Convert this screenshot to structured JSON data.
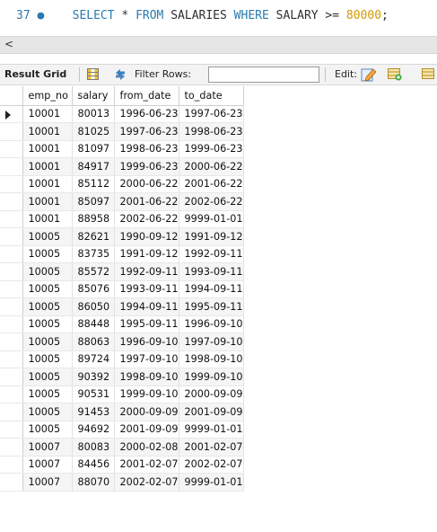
{
  "editor": {
    "line_number": "37",
    "line_dot": "●",
    "sql": {
      "kw_select": "SELECT",
      "star": " * ",
      "kw_from": "FROM",
      "table": " SALARIES ",
      "kw_where": "WHERE",
      "cond": " SALARY >= ",
      "value": "80000",
      "end": ";"
    },
    "colors": {
      "keyword": "#2a7ab0",
      "number": "#d19a00"
    }
  },
  "hscroll": {
    "left_arrow": "<"
  },
  "toolbar": {
    "result_grid_label": "Result Grid",
    "filter_label": "Filter Rows:",
    "filter_value": "",
    "edit_label": "Edit:"
  },
  "table": {
    "columns": [
      "emp_no",
      "salary",
      "from_date",
      "to_date"
    ],
    "rows": [
      [
        "10001",
        "80013",
        "1996-06-23",
        "1997-06-23"
      ],
      [
        "10001",
        "81025",
        "1997-06-23",
        "1998-06-23"
      ],
      [
        "10001",
        "81097",
        "1998-06-23",
        "1999-06-23"
      ],
      [
        "10001",
        "84917",
        "1999-06-23",
        "2000-06-22"
      ],
      [
        "10001",
        "85112",
        "2000-06-22",
        "2001-06-22"
      ],
      [
        "10001",
        "85097",
        "2001-06-22",
        "2002-06-22"
      ],
      [
        "10001",
        "88958",
        "2002-06-22",
        "9999-01-01"
      ],
      [
        "10005",
        "82621",
        "1990-09-12",
        "1991-09-12"
      ],
      [
        "10005",
        "83735",
        "1991-09-12",
        "1992-09-11"
      ],
      [
        "10005",
        "85572",
        "1992-09-11",
        "1993-09-11"
      ],
      [
        "10005",
        "85076",
        "1993-09-11",
        "1994-09-11"
      ],
      [
        "10005",
        "86050",
        "1994-09-11",
        "1995-09-11"
      ],
      [
        "10005",
        "88448",
        "1995-09-11",
        "1996-09-10"
      ],
      [
        "10005",
        "88063",
        "1996-09-10",
        "1997-09-10"
      ],
      [
        "10005",
        "89724",
        "1997-09-10",
        "1998-09-10"
      ],
      [
        "10005",
        "90392",
        "1998-09-10",
        "1999-09-10"
      ],
      [
        "10005",
        "90531",
        "1999-09-10",
        "2000-09-09"
      ],
      [
        "10005",
        "91453",
        "2000-09-09",
        "2001-09-09"
      ],
      [
        "10005",
        "94692",
        "2001-09-09",
        "9999-01-01"
      ],
      [
        "10007",
        "80083",
        "2000-02-08",
        "2001-02-07"
      ],
      [
        "10007",
        "84456",
        "2001-02-07",
        "2002-02-07"
      ],
      [
        "10007",
        "88070",
        "2002-02-07",
        "9999-01-01"
      ]
    ]
  }
}
